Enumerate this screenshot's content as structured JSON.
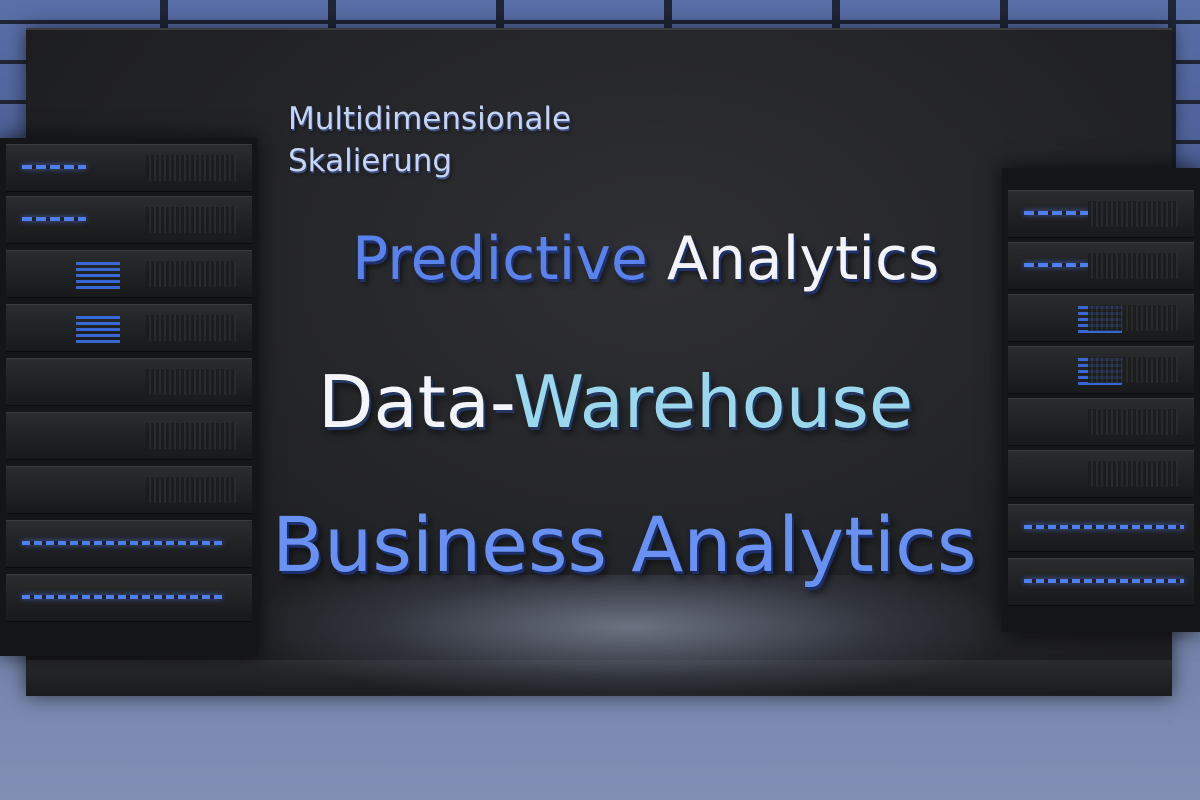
{
  "scene": {
    "words": {
      "mds_line1": "Multidimensionale",
      "mds_line2": "Skalierung",
      "predictive": "Predictive",
      "analytics_1": " Analytics",
      "data": "Data-",
      "warehouse": "Warehouse",
      "business_analytics": "Business Analytics"
    },
    "colors": {
      "led_blue": "#4e7ff2",
      "word_blue": "#6891f3",
      "word_cyan": "#9bd8ee",
      "word_white": "#f2f4fa",
      "panel": "#222326",
      "floor": "#7686ad"
    }
  }
}
